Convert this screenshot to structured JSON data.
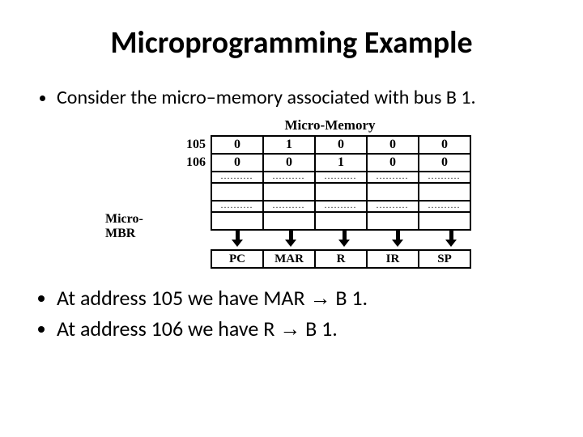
{
  "title": "Microprogramming Example",
  "bullet_intro": "Consider the micro–memory associated with bus B 1.",
  "diagram": {
    "top_label": "Micro-Memory",
    "left_label": "Micro-MBR",
    "addresses": [
      "105",
      "106"
    ],
    "rows": [
      [
        "0",
        "1",
        "0",
        "0",
        "0"
      ],
      [
        "0",
        "0",
        "1",
        "0",
        "0"
      ]
    ],
    "columns": [
      "PC",
      "MAR",
      "R",
      "IR",
      "SP"
    ]
  },
  "bullets_out": [
    {
      "pre": "At address 105 we have MAR ",
      "arrow": "→",
      "post": " B 1."
    },
    {
      "pre": "At address 106 we have R ",
      "arrow": "→",
      "post": " B 1."
    }
  ],
  "dots": ".........."
}
